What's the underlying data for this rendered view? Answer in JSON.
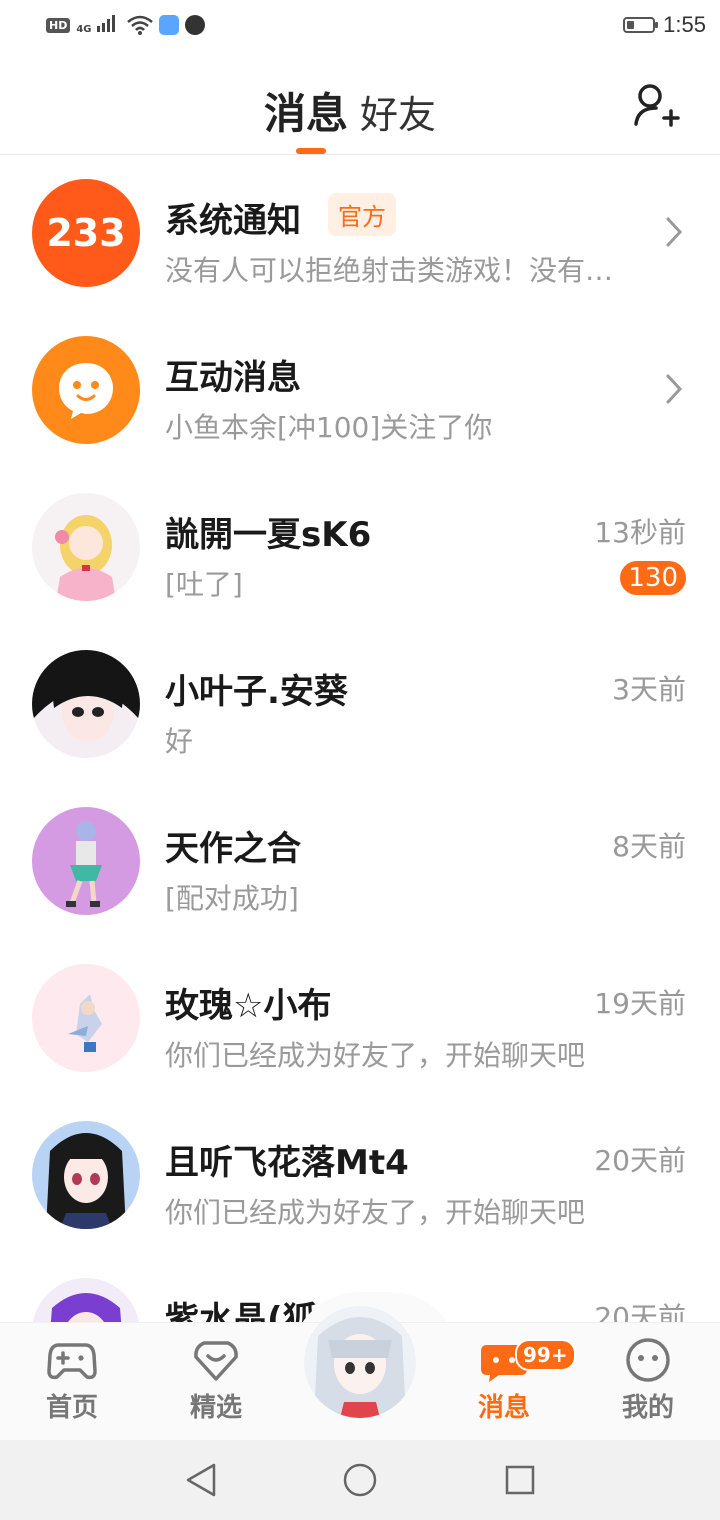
{
  "status_bar": {
    "hd_label": "HD",
    "network_label": "4G",
    "time": "1:55",
    "battery_level": 0.3
  },
  "header": {
    "tab_active": "消息",
    "tab_other": "好友"
  },
  "conversations": [
    {
      "title": "系统通知",
      "badge": "官方",
      "preview": "没有人可以拒绝射击类游戏！没有人可以拒绝",
      "avatar_text": "233"
    },
    {
      "title": "互动消息",
      "preview": "小鱼本余[冲100]关注了你"
    },
    {
      "title": "詤開一夏sK6",
      "time": "13秒前",
      "preview": "[吐了]",
      "unread": "130"
    },
    {
      "title": "小叶子.安葵",
      "time": "3天前",
      "preview": "好"
    },
    {
      "title": "天作之合",
      "time": "8天前",
      "preview": "[配对成功]"
    },
    {
      "title": "玫瑰☆小布",
      "time": "19天前",
      "preview": "你们已经成为好友了，开始聊天吧"
    },
    {
      "title": "且听飞花落Mt4",
      "time": "20天前",
      "preview": "你们已经成为好友了，开始聊天吧"
    },
    {
      "title": "紫水晶(狐仙",
      "time": "20天前",
      "preview": ""
    }
  ],
  "bottom_nav": {
    "home": "首页",
    "featured": "精选",
    "messages": "消息",
    "messages_badge": "99+",
    "me": "我的"
  },
  "colors": {
    "accent": "#ff6a14"
  }
}
